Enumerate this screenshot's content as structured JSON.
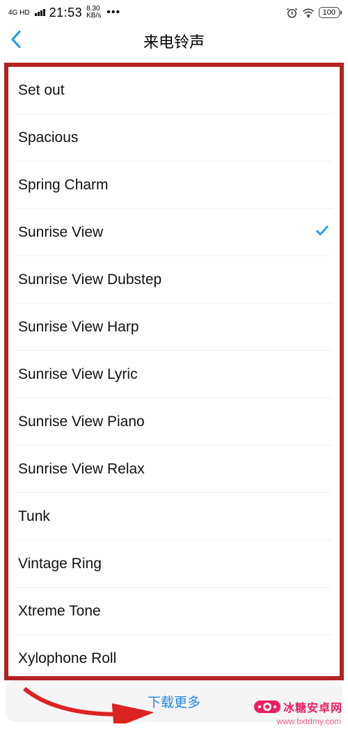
{
  "status": {
    "network_type": "4G HD",
    "time": "21:53",
    "speed_val": "8.30",
    "speed_unit": "KB/s",
    "battery": "100"
  },
  "nav": {
    "title": "来电铃声"
  },
  "ringtones": [
    {
      "name": "Set out",
      "selected": false
    },
    {
      "name": "Spacious",
      "selected": false
    },
    {
      "name": "Spring Charm",
      "selected": false
    },
    {
      "name": "Sunrise View",
      "selected": true
    },
    {
      "name": "Sunrise View Dubstep",
      "selected": false
    },
    {
      "name": "Sunrise View Harp",
      "selected": false
    },
    {
      "name": "Sunrise View Lyric",
      "selected": false
    },
    {
      "name": "Sunrise View Piano",
      "selected": false
    },
    {
      "name": "Sunrise View Relax",
      "selected": false
    },
    {
      "name": "Tunk",
      "selected": false
    },
    {
      "name": "Vintage Ring",
      "selected": false
    },
    {
      "name": "Xtreme Tone",
      "selected": false
    },
    {
      "name": "Xylophone Roll",
      "selected": false
    }
  ],
  "footer": {
    "download_more": "下载更多"
  },
  "watermark": {
    "text": "冰糖安卓网",
    "url": "www.bxtdmy.com"
  }
}
